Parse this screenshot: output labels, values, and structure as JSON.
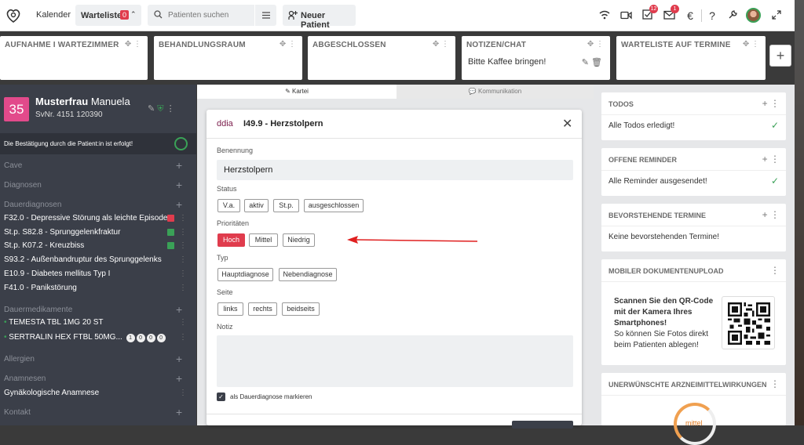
{
  "topbar": {
    "calendar_label": "Kalender",
    "waitlist_label": "Warteliste",
    "waitlist_count": "0",
    "search_placeholder": "Patienten suchen",
    "new_patient_label": "Neuer Patient",
    "tasks_badge": "12",
    "mail_badge": "1"
  },
  "columns": [
    {
      "title": "AUFNAHME I WARTEZIMMER"
    },
    {
      "title": "BEHANDLUNGSRAUM"
    },
    {
      "title": "ABGESCHLOSSEN"
    },
    {
      "title": "NOTIZEN/CHAT",
      "note": "Bitte Kaffee bringen!"
    },
    {
      "title": "WARTELISTE AUF TERMINE"
    }
  ],
  "patient": {
    "number": "35",
    "last_name": "Musterfrau",
    "first_name": "Manuela",
    "svnr": "SvNr. 4151  120390",
    "confirmation": "Die Bestätigung durch die Patient:in ist erfolgt!"
  },
  "sidebar": {
    "cave": "Cave",
    "diagnosen": "Diagnosen",
    "dauerdiagnosen": "Dauerdiagnosen",
    "diagnoses": [
      {
        "text": "F32.0 - Depressive Störung als leichte Episode",
        "color": "#e03c4d"
      },
      {
        "text": "St.p. S82.8 - Sprunggelenkfraktur",
        "color": "#3aa157"
      },
      {
        "text": "St.p. K07.2 - Kreuzbiss",
        "color": "#3aa157"
      },
      {
        "text": "S93.2 - Außenbandruptur des Sprunggelenks",
        "color": ""
      },
      {
        "text": "E10.9 - Diabetes mellitus Typ I",
        "color": ""
      },
      {
        "text": "F41.0 - Panikstörung",
        "color": ""
      }
    ],
    "dauermedikamente": "Dauermedikamente",
    "medications": [
      {
        "text": "TEMESTA TBL 1MG 20 ST",
        "doses": []
      },
      {
        "text": "SERTRALIN HEX FTBL 50MG...",
        "doses": [
          "1",
          "0",
          "0",
          "0"
        ]
      }
    ],
    "allergien": "Allergien",
    "anamnesen": "Anamnesen",
    "anamnese_item": "Gynäkologische Anamnese",
    "kontakt": "Kontakt"
  },
  "tabs": {
    "kartei": "Kartei",
    "kommunikation": "Kommunikation"
  },
  "modal": {
    "code_prefix": "ddia",
    "title": "I49.9 - Herzstolpern",
    "benennung_label": "Benennung",
    "benennung_value": "Herzstolpern",
    "status_label": "Status",
    "status_options": [
      "V.a.",
      "aktiv",
      "St.p.",
      "ausgeschlossen"
    ],
    "prioritaeten_label": "Prioritäten",
    "priority_options": [
      "Hoch",
      "Mittel",
      "Niedrig"
    ],
    "priority_selected": "Hoch",
    "typ_label": "Typ",
    "typ_options": [
      "Hauptdiagnose",
      "Nebendiagnose"
    ],
    "seite_label": "Seite",
    "seite_options": [
      "links",
      "rechts",
      "beidseits"
    ],
    "notiz_label": "Notiz",
    "dauer_checkbox_label": "als Dauerdiagnose markieren",
    "dauer_checked": true
  },
  "cards": {
    "todos": {
      "title": "TODOS",
      "body": "Alle Todos erledigt!"
    },
    "reminder": {
      "title": "OFFENE REMINDER",
      "body": "Alle Reminder ausgesendet!"
    },
    "termine": {
      "title": "BEVORSTEHENDE TERMINE",
      "body": "Keine bevorstehenden Termine!"
    },
    "upload": {
      "title": "MOBILER DOKUMENTENUPLOAD",
      "qr_heading": "Scannen Sie den QR-Code mit der Kamera Ihres Smartphones!",
      "qr_sub": "So können Sie Fotos direkt beim Patienten ablegen!"
    },
    "uaw": {
      "title": "UNERWÜNSCHTE ARZNEIMITTELWIRKUNGEN",
      "gauge_label": "mittel"
    }
  },
  "colors": {
    "accent_red": "#e03c4d",
    "accent_green": "#3aa157",
    "sidebar": "#3b3f49",
    "patient_pink": "#e24a8b"
  }
}
